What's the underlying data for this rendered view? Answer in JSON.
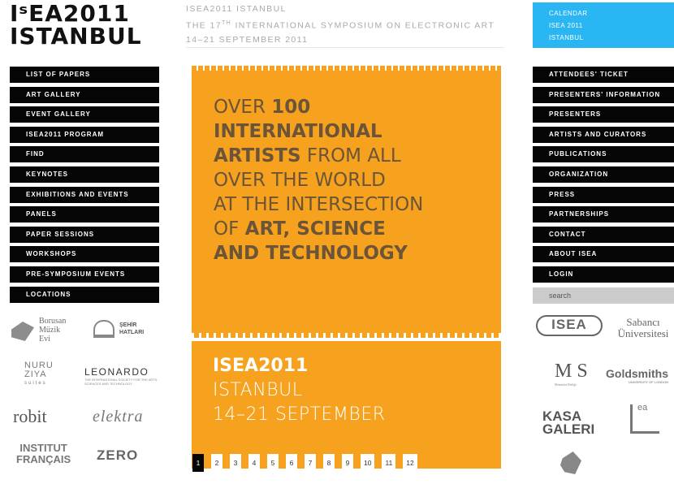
{
  "logo": {
    "line1": "IˢEA2011",
    "line2": "ISTANBUL"
  },
  "header": {
    "line1": "ISEA2011 ISTANBUL",
    "line2_pre": "THE 17",
    "line2_sup": "TH",
    "line2_post": " INTERNATIONAL SYMPOSIUM ON ELECTRONIC ART",
    "line3": "14–21 SEPTEMBER 2011"
  },
  "calendar": {
    "items": [
      "CALENDAR",
      "ISEA 2011",
      "ISTANBUL"
    ]
  },
  "left_nav": [
    "LIST OF PAPERS",
    "ART GALLERY",
    "EVENT GALLERY",
    "ISEA2011 PROGRAM",
    "FIND",
    "KEYNOTES",
    "EXHIBITIONS AND EVENTS",
    "PANELS",
    "PAPER SESSIONS",
    "WORKSHOPS",
    "PRE-SYMPOSIUM EVENTS",
    "LOCATIONS"
  ],
  "right_nav": [
    "ATTENDEES' TICKET",
    "PRESENTERS' INFORMATION",
    "PRESENTERS",
    "ARTISTS AND CURATORS",
    "PUBLICATIONS",
    "ORGANIZATION",
    "PRESS",
    "PARTNERSHIPS",
    "CONTACT",
    "ABOUT ISEA",
    "LOGIN"
  ],
  "search": {
    "placeholder": "search"
  },
  "sponsors_left": {
    "borusan": "Borusan\nMüzik\nEvi",
    "sehir": "ŞEHİR\nHATLARI",
    "nuru": "NURU\nZIYA",
    "nuru_sub": "suites",
    "leonardo": "LEONARDO",
    "leonardo_sub": "THE INTERNATIONAL SOCIETY FOR THE ARTS, SCIENCES AND TECHNOLOGY",
    "robit": "robit",
    "elektra": "elektra",
    "institut": "INSTITUT\nFRANÇAIS",
    "zero": "ZERO"
  },
  "sponsors_right": {
    "isea": "ISEA",
    "sabanci": "Sabancı\nÜniversitesi",
    "ms": "M S",
    "ms_sub": "Mimarlar Birliği",
    "goldsmiths": "Goldsmiths",
    "goldsmiths_sub": "UNIVERSITY OF LONDON",
    "kasa": "KASA\nGALERI",
    "lea": "ea"
  },
  "poster": {
    "tag1_pre": "OVER ",
    "tag1_b": "100",
    "tag2_b": "INTERNATIONAL",
    "tag3_b": "ARTISTS",
    "tag3_post": " FROM ALL",
    "tag4": "OVER THE WORLD",
    "tag5": "AT THE INTERSECTION",
    "tag6_pre": "OF ",
    "tag6_b": "ART, SCIENCE",
    "tag7_b": "AND TECHNOLOGY",
    "title": "ISEA2011",
    "city": "ISTANBUL",
    "dates": "14–21 SEPTEMBER"
  },
  "pager": {
    "pages": [
      "1",
      "2",
      "3",
      "4",
      "5",
      "6",
      "7",
      "8",
      "9",
      "10",
      "11",
      "12"
    ],
    "active": "1"
  }
}
